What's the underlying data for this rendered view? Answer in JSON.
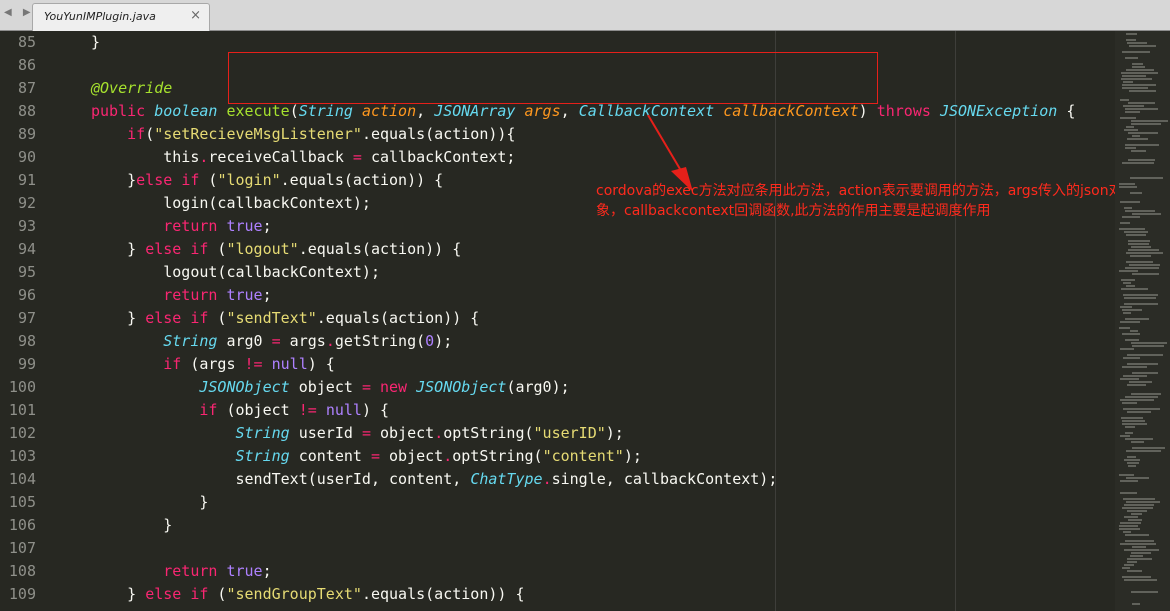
{
  "tab": {
    "title": "YouYunIMPlugin.java"
  },
  "annotation": {
    "line1": "cordova的exec方法对应条用此方法，action表示要调用的方法，args传入的json对",
    "line2": "象，callbackcontext回调函数,此方法的作用主要是起调度作用"
  },
  "code_lines": [
    {
      "num": "85",
      "indent": 1,
      "tokens": [
        [
          "p",
          "}"
        ]
      ]
    },
    {
      "num": "86",
      "indent": 0,
      "tokens": []
    },
    {
      "num": "87",
      "indent": 1,
      "tokens": [
        [
          "an",
          "@Override"
        ]
      ]
    },
    {
      "num": "88",
      "indent": 1,
      "tokens": [
        [
          "kw",
          "public"
        ],
        [
          "p",
          " "
        ],
        [
          "ty",
          "boolean"
        ],
        [
          "p",
          " "
        ],
        [
          "fn",
          "execute"
        ],
        [
          "p",
          "("
        ],
        [
          "ty",
          "String"
        ],
        [
          "p",
          " "
        ],
        [
          "pa",
          "action"
        ],
        [
          "p",
          ", "
        ],
        [
          "ty",
          "JSONArray"
        ],
        [
          "p",
          " "
        ],
        [
          "pa",
          "args"
        ],
        [
          "p",
          ", "
        ],
        [
          "ty",
          "CallbackContext"
        ],
        [
          "p",
          " "
        ],
        [
          "pa",
          "callbackContext"
        ],
        [
          "p",
          ") "
        ],
        [
          "kw",
          "throws"
        ],
        [
          "p",
          " "
        ],
        [
          "ty",
          "JSONException"
        ],
        [
          "p",
          " {"
        ]
      ]
    },
    {
      "num": "89",
      "indent": 2,
      "tokens": [
        [
          "kw",
          "if"
        ],
        [
          "p",
          "("
        ],
        [
          "st",
          "\"setRecieveMsgListener\""
        ],
        [
          "p",
          ".equals(action)){"
        ]
      ]
    },
    {
      "num": "90",
      "indent": 3,
      "tokens": [
        [
          "p",
          "this"
        ],
        [
          "op",
          "."
        ],
        [
          "p",
          "receiveCallback "
        ],
        [
          "op",
          "="
        ],
        [
          "p",
          " callbackContext;"
        ]
      ]
    },
    {
      "num": "91",
      "indent": 2,
      "tokens": [
        [
          "p",
          "}"
        ],
        [
          "kw",
          "else"
        ],
        [
          "p",
          " "
        ],
        [
          "kw",
          "if"
        ],
        [
          "p",
          " ("
        ],
        [
          "st",
          "\"login\""
        ],
        [
          "p",
          ".equals(action)) {"
        ]
      ]
    },
    {
      "num": "92",
      "indent": 3,
      "tokens": [
        [
          "p",
          "login(callbackContext);"
        ]
      ]
    },
    {
      "num": "93",
      "indent": 3,
      "tokens": [
        [
          "kw",
          "return"
        ],
        [
          "p",
          " "
        ],
        [
          "cn",
          "true"
        ],
        [
          "p",
          ";"
        ]
      ]
    },
    {
      "num": "94",
      "indent": 2,
      "tokens": [
        [
          "p",
          "} "
        ],
        [
          "kw",
          "else"
        ],
        [
          "p",
          " "
        ],
        [
          "kw",
          "if"
        ],
        [
          "p",
          " ("
        ],
        [
          "st",
          "\"logout\""
        ],
        [
          "p",
          ".equals(action)) {"
        ]
      ]
    },
    {
      "num": "95",
      "indent": 3,
      "tokens": [
        [
          "p",
          "logout(callbackContext);"
        ]
      ]
    },
    {
      "num": "96",
      "indent": 3,
      "tokens": [
        [
          "kw",
          "return"
        ],
        [
          "p",
          " "
        ],
        [
          "cn",
          "true"
        ],
        [
          "p",
          ";"
        ]
      ]
    },
    {
      "num": "97",
      "indent": 2,
      "tokens": [
        [
          "p",
          "} "
        ],
        [
          "kw",
          "else"
        ],
        [
          "p",
          " "
        ],
        [
          "kw",
          "if"
        ],
        [
          "p",
          " ("
        ],
        [
          "st",
          "\"sendText\""
        ],
        [
          "p",
          ".equals(action)) {"
        ]
      ]
    },
    {
      "num": "98",
      "indent": 3,
      "tokens": [
        [
          "ty",
          "String"
        ],
        [
          "p",
          " arg0 "
        ],
        [
          "op",
          "="
        ],
        [
          "p",
          " args"
        ],
        [
          "op",
          "."
        ],
        [
          "p",
          "getString("
        ],
        [
          "cn",
          "0"
        ],
        [
          "p",
          ");"
        ]
      ]
    },
    {
      "num": "99",
      "indent": 3,
      "tokens": [
        [
          "kw",
          "if"
        ],
        [
          "p",
          " (args "
        ],
        [
          "op",
          "!="
        ],
        [
          "p",
          " "
        ],
        [
          "cn",
          "null"
        ],
        [
          "p",
          ") {"
        ]
      ]
    },
    {
      "num": "100",
      "indent": 4,
      "tokens": [
        [
          "ty",
          "JSONObject"
        ],
        [
          "p",
          " object "
        ],
        [
          "op",
          "="
        ],
        [
          "p",
          " "
        ],
        [
          "kw",
          "new"
        ],
        [
          "p",
          " "
        ],
        [
          "ty",
          "JSONObject"
        ],
        [
          "p",
          "(arg0);"
        ]
      ]
    },
    {
      "num": "101",
      "indent": 4,
      "tokens": [
        [
          "kw",
          "if"
        ],
        [
          "p",
          " (object "
        ],
        [
          "op",
          "!="
        ],
        [
          "p",
          " "
        ],
        [
          "cn",
          "null"
        ],
        [
          "p",
          ") {"
        ]
      ]
    },
    {
      "num": "102",
      "indent": 5,
      "tokens": [
        [
          "ty",
          "String"
        ],
        [
          "p",
          " userId "
        ],
        [
          "op",
          "="
        ],
        [
          "p",
          " object"
        ],
        [
          "op",
          "."
        ],
        [
          "p",
          "optString("
        ],
        [
          "st",
          "\"userID\""
        ],
        [
          "p",
          ");"
        ]
      ]
    },
    {
      "num": "103",
      "indent": 5,
      "tokens": [
        [
          "ty",
          "String"
        ],
        [
          "p",
          " content "
        ],
        [
          "op",
          "="
        ],
        [
          "p",
          " object"
        ],
        [
          "op",
          "."
        ],
        [
          "p",
          "optString("
        ],
        [
          "st",
          "\"content\""
        ],
        [
          "p",
          ");"
        ]
      ]
    },
    {
      "num": "104",
      "indent": 5,
      "tokens": [
        [
          "p",
          "sendText(userId, content, "
        ],
        [
          "ty",
          "ChatType"
        ],
        [
          "op",
          "."
        ],
        [
          "p",
          "single, callbackContext);"
        ]
      ]
    },
    {
      "num": "105",
      "indent": 4,
      "tokens": [
        [
          "p",
          "}"
        ]
      ]
    },
    {
      "num": "106",
      "indent": 3,
      "tokens": [
        [
          "p",
          "}"
        ]
      ]
    },
    {
      "num": "107",
      "indent": 0,
      "tokens": []
    },
    {
      "num": "108",
      "indent": 3,
      "tokens": [
        [
          "kw",
          "return"
        ],
        [
          "p",
          " "
        ],
        [
          "cn",
          "true"
        ],
        [
          "p",
          ";"
        ]
      ]
    },
    {
      "num": "109",
      "indent": 2,
      "tokens": [
        [
          "p",
          "} "
        ],
        [
          "kw",
          "else"
        ],
        [
          "p",
          " "
        ],
        [
          "kw",
          "if"
        ],
        [
          "p",
          " ("
        ],
        [
          "st",
          "\"sendGroupText\""
        ],
        [
          "p",
          ".equals(action)) {"
        ]
      ]
    }
  ]
}
